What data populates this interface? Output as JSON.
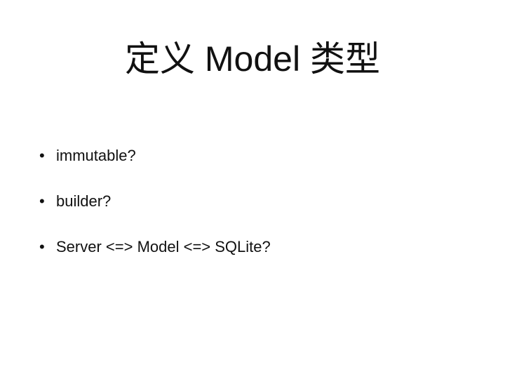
{
  "slide": {
    "title": "定义 Model 类型",
    "bullets": [
      {
        "marker": "•",
        "text": "immutable?"
      },
      {
        "marker": "•",
        "text": "builder?"
      },
      {
        "marker": "•",
        "text": "Server <=> Model <=> SQLite?"
      }
    ]
  }
}
